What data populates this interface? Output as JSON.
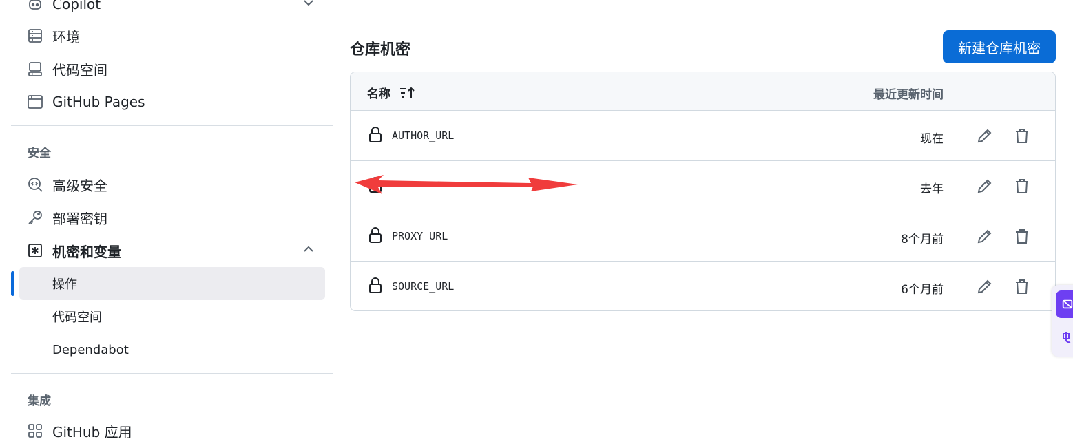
{
  "sidebar": {
    "items_top": [
      {
        "label": "Copilot",
        "icon": "copilot-icon"
      },
      {
        "label": "环境",
        "icon": "server-icon"
      },
      {
        "label": "代码空间",
        "icon": "codespaces-icon"
      },
      {
        "label": "GitHub Pages",
        "icon": "browser-icon"
      }
    ],
    "security_title": "安全",
    "items_security": [
      {
        "label": "高级安全",
        "icon": "codescan-icon"
      },
      {
        "label": "部署密钥",
        "icon": "key-icon"
      },
      {
        "label": "机密和变量",
        "icon": "asterisk-icon"
      }
    ],
    "sub_items": [
      {
        "label": "操作",
        "active": true
      },
      {
        "label": "代码空间",
        "active": false
      },
      {
        "label": "Dependabot",
        "active": false
      }
    ],
    "integrations_title": "集成",
    "items_integrations": [
      {
        "label": "GitHub 应用",
        "icon": "apps-icon"
      }
    ]
  },
  "main": {
    "title": "仓库机密",
    "new_button": "新建仓库机密",
    "table": {
      "col_name": "名称",
      "col_time": "最近更新时间",
      "rows": [
        {
          "name": "AUTHOR_URL",
          "time": "现在"
        },
        {
          "name": "",
          "time": "去年",
          "redacted": true
        },
        {
          "name": "PROXY_URL",
          "time": "8个月前"
        },
        {
          "name": "SOURCE_URL",
          "time": "6个月前"
        }
      ]
    }
  },
  "colors": {
    "primary_button": "#0a6cd6",
    "active_indicator": "#0969da",
    "redaction_arrow": "#f03c3c",
    "widget_accent": "#6e3ff2"
  }
}
